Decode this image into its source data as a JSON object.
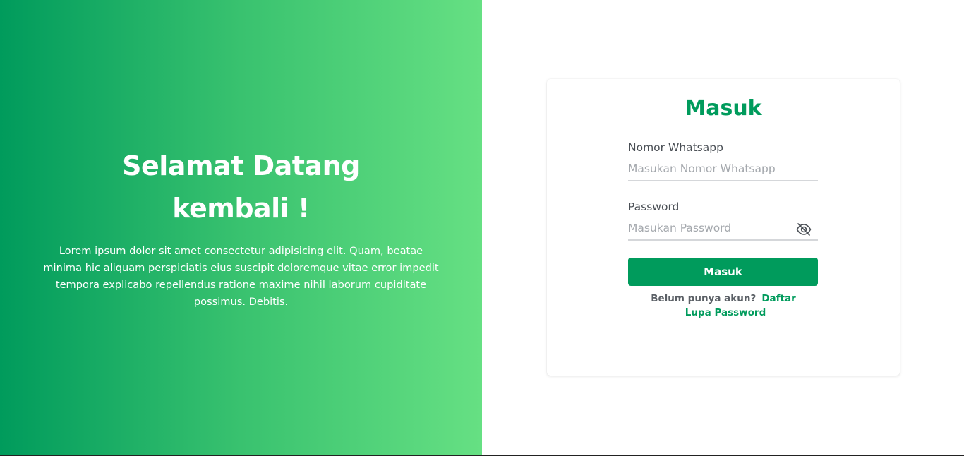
{
  "hero": {
    "title_line1": "Selamat Datang",
    "title_line2": "kembali !",
    "description": "Lorem ipsum dolor sit amet consectetur adipisicing elit. Quam, beatae minima hic aliquam perspiciatis eius suscipit doloremque vitae error impedit tempora explicabo repellendus ratione maxime nihil laborum cupiditate possimus. Debitis."
  },
  "login": {
    "title": "Masuk",
    "whatsapp_label": "Nomor Whatsapp",
    "whatsapp_placeholder": "Masukan Nomor Whatsapp",
    "password_label": "Password",
    "password_placeholder": "Masukan Password",
    "password_toggle_icon": "eye-off-icon",
    "submit_label": "Masuk",
    "no_account_text": "Belum punya akun?",
    "register_link": "Daftar",
    "forgot_link": "Lupa Password"
  },
  "colors": {
    "brand": "#009b5c",
    "gradient_start": "#009b5c",
    "gradient_end": "#66e083"
  }
}
